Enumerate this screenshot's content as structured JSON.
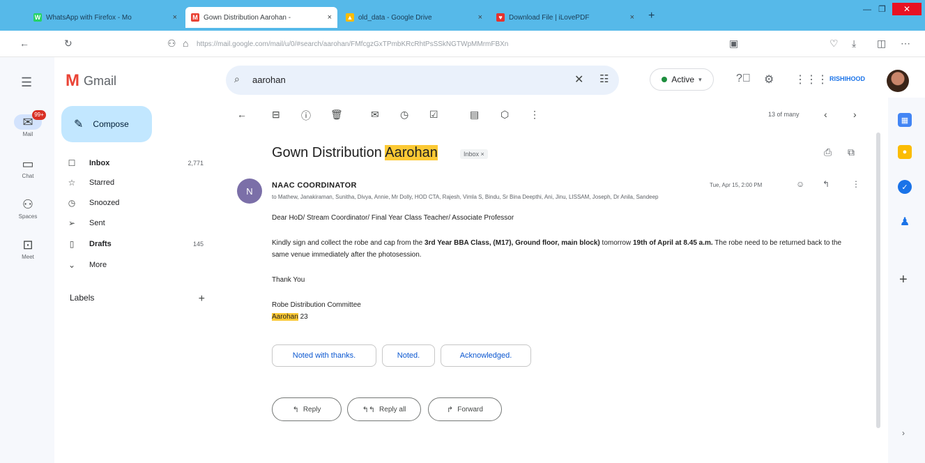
{
  "browser": {
    "tabs": [
      {
        "title": "WhatsApp with Firefox - Mo",
        "fav_color": "#25d366",
        "fav_glyph": "W"
      },
      {
        "title": "Gown Distribution Aarohan - ",
        "fav_color": "#ea4335",
        "fav_glyph": "M"
      },
      {
        "title": "old_data - Google Drive",
        "fav_color": "#fbbc04",
        "fav_glyph": "▲"
      },
      {
        "title": "Download File | iLovePDF",
        "fav_color": "#e5322d",
        "fav_glyph": "♥"
      }
    ],
    "url_domain": "google.com",
    "url_text": "https://mail.google.com/mail/u/0/#search/aarohan/FMfcgzGxTPmbKRcRhtPsSSkNGTWpMMrmFBXn"
  },
  "rail": {
    "items": [
      {
        "label": "Mail",
        "badge": "99+"
      },
      {
        "label": "Chat"
      },
      {
        "label": "Spaces"
      },
      {
        "label": "Meet"
      }
    ]
  },
  "app": {
    "name": "Gmail"
  },
  "search": {
    "query": "aarohan"
  },
  "status": {
    "label": "Active"
  },
  "org_logo": {
    "text": "RISHIHOOD"
  },
  "compose": {
    "label": "Compose"
  },
  "nav": {
    "items": [
      {
        "label": "Inbox",
        "count": "2,771",
        "icon": "inbox-icon",
        "bold": true
      },
      {
        "label": "Starred",
        "count": "",
        "icon": "star-icon"
      },
      {
        "label": "Snoozed",
        "count": "",
        "icon": "clock-icon"
      },
      {
        "label": "Sent",
        "count": "",
        "icon": "send-icon"
      },
      {
        "label": "Drafts",
        "count": "145",
        "icon": "draft-icon",
        "bold": true
      },
      {
        "label": "More",
        "count": "",
        "icon": "chevron-down-icon"
      }
    ],
    "labels_heading": "Labels"
  },
  "message_toolbar": {
    "count_text": "13 of many"
  },
  "message": {
    "subject_pre": "Gown Distribution ",
    "subject_highlight": "Aarohan",
    "subject_label": "Inbox ×",
    "sender_initials": "N",
    "sender": "NAAC COORDINATOR",
    "recipients": "to Mathew, Janakiraman, Sunitha, Divya, Annie, Mr Dolly, HOD CTA, Rajesh, Vimla S, Bindu, Sr Bina Deepthi, Ani, Jinu, LISSAM, Joseph, Dr Anila, Sandeep",
    "date": "Tue, Apr 15, 2:00 PM",
    "greeting": "Dear HoD/ Stream Coordinator/ Final Year Class Teacher/ Associate Professor",
    "para1_a": "Kindly sign and collect the robe and cap from the ",
    "para1_b": "3rd Year BBA Class, (M17), Ground floor, main block)",
    "para1_c": " tomorrow ",
    "para1_d": "19th of April at 8.45 a.m.",
    "para1_e": " The robe need to be returned back to the same venue immediately after the photosession.",
    "thanks": "Thank You",
    "signature_line": "Robe Distribution Committee",
    "signature_highlight": "Aarohan",
    "signature_suffix": " 23"
  },
  "smart_replies": [
    "Noted with thanks.",
    "Noted.",
    "Acknowledged."
  ],
  "reply_actions": [
    {
      "label": "Reply",
      "icon": "reply-icon"
    },
    {
      "label": "Reply all",
      "icon": "reply-all-icon"
    },
    {
      "label": "Forward",
      "icon": "forward-icon"
    }
  ]
}
